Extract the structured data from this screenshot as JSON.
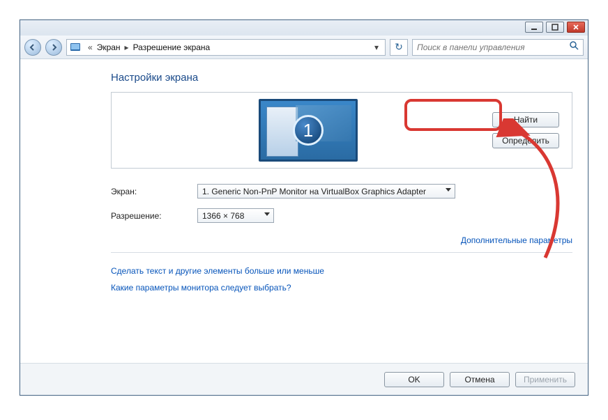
{
  "breadcrumb": {
    "root_marker": "«",
    "level1": "Экран",
    "level2": "Разрешение экрана"
  },
  "search": {
    "placeholder": "Поиск в панели управления"
  },
  "heading": "Настройки экрана",
  "monitor": {
    "number": "1"
  },
  "side_buttons": {
    "find": "Найти",
    "identify": "Определить"
  },
  "form": {
    "screen_label": "Экран:",
    "screen_value": "1. Generic Non-PnP Monitor на VirtualBox Graphics Adapter",
    "resolution_label": "Разрешение:",
    "resolution_value": "1366 × 768"
  },
  "links": {
    "advanced": "Дополнительные параметры",
    "text_size": "Сделать текст и другие элементы больше или меньше",
    "which_settings": "Какие параметры монитора следует выбрать?"
  },
  "footer": {
    "ok": "OK",
    "cancel": "Отмена",
    "apply": "Применить"
  }
}
